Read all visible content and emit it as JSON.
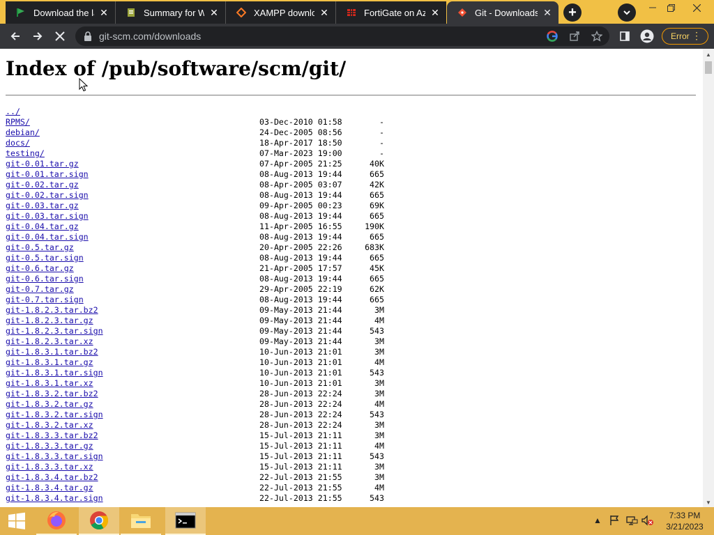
{
  "browser": {
    "tabs": [
      {
        "title": "Download the lat",
        "favicon": "flag-icon",
        "active": false
      },
      {
        "title": "Summary for Win",
        "favicon": "document-icon",
        "active": false
      },
      {
        "title": "XAMPP downloac",
        "favicon": "xampp-icon",
        "active": false
      },
      {
        "title": "FortiGate on Azu",
        "favicon": "fortinet-icon",
        "active": false
      },
      {
        "title": "Git - Downloads",
        "favicon": "git-icon",
        "active": true
      }
    ],
    "url": "git-scm.com/downloads",
    "error_label": "Error"
  },
  "page": {
    "heading": "Index of /pub/software/scm/git/",
    "entries": [
      {
        "name": "../",
        "date": "",
        "size": ""
      },
      {
        "name": "RPMS/",
        "date": "03-Dec-2010 01:58",
        "size": "-"
      },
      {
        "name": "debian/",
        "date": "24-Dec-2005 08:56",
        "size": "-"
      },
      {
        "name": "docs/",
        "date": "18-Apr-2017 18:50",
        "size": "-"
      },
      {
        "name": "testing/",
        "date": "07-Mar-2023 19:00",
        "size": "-"
      },
      {
        "name": "git-0.01.tar.gz",
        "date": "07-Apr-2005 21:25",
        "size": "40K"
      },
      {
        "name": "git-0.01.tar.sign",
        "date": "08-Aug-2013 19:44",
        "size": "665"
      },
      {
        "name": "git-0.02.tar.gz",
        "date": "08-Apr-2005 03:07",
        "size": "42K"
      },
      {
        "name": "git-0.02.tar.sign",
        "date": "08-Aug-2013 19:44",
        "size": "665"
      },
      {
        "name": "git-0.03.tar.gz",
        "date": "09-Apr-2005 00:23",
        "size": "69K"
      },
      {
        "name": "git-0.03.tar.sign",
        "date": "08-Aug-2013 19:44",
        "size": "665"
      },
      {
        "name": "git-0.04.tar.gz",
        "date": "11-Apr-2005 16:55",
        "size": "190K"
      },
      {
        "name": "git-0.04.tar.sign",
        "date": "08-Aug-2013 19:44",
        "size": "665"
      },
      {
        "name": "git-0.5.tar.gz",
        "date": "20-Apr-2005 22:26",
        "size": "683K"
      },
      {
        "name": "git-0.5.tar.sign",
        "date": "08-Aug-2013 19:44",
        "size": "665"
      },
      {
        "name": "git-0.6.tar.gz",
        "date": "21-Apr-2005 17:57",
        "size": "45K"
      },
      {
        "name": "git-0.6.tar.sign",
        "date": "08-Aug-2013 19:44",
        "size": "665"
      },
      {
        "name": "git-0.7.tar.gz",
        "date": "29-Apr-2005 22:19",
        "size": "62K"
      },
      {
        "name": "git-0.7.tar.sign",
        "date": "08-Aug-2013 19:44",
        "size": "665"
      },
      {
        "name": "git-1.8.2.3.tar.bz2",
        "date": "09-May-2013 21:44",
        "size": "3M"
      },
      {
        "name": "git-1.8.2.3.tar.gz",
        "date": "09-May-2013 21:44",
        "size": "4M"
      },
      {
        "name": "git-1.8.2.3.tar.sign",
        "date": "09-May-2013 21:44",
        "size": "543"
      },
      {
        "name": "git-1.8.2.3.tar.xz",
        "date": "09-May-2013 21:44",
        "size": "3M"
      },
      {
        "name": "git-1.8.3.1.tar.bz2",
        "date": "10-Jun-2013 21:01",
        "size": "3M"
      },
      {
        "name": "git-1.8.3.1.tar.gz",
        "date": "10-Jun-2013 21:01",
        "size": "4M"
      },
      {
        "name": "git-1.8.3.1.tar.sign",
        "date": "10-Jun-2013 21:01",
        "size": "543"
      },
      {
        "name": "git-1.8.3.1.tar.xz",
        "date": "10-Jun-2013 21:01",
        "size": "3M"
      },
      {
        "name": "git-1.8.3.2.tar.bz2",
        "date": "28-Jun-2013 22:24",
        "size": "3M"
      },
      {
        "name": "git-1.8.3.2.tar.gz",
        "date": "28-Jun-2013 22:24",
        "size": "4M"
      },
      {
        "name": "git-1.8.3.2.tar.sign",
        "date": "28-Jun-2013 22:24",
        "size": "543"
      },
      {
        "name": "git-1.8.3.2.tar.xz",
        "date": "28-Jun-2013 22:24",
        "size": "3M"
      },
      {
        "name": "git-1.8.3.3.tar.bz2",
        "date": "15-Jul-2013 21:11",
        "size": "3M"
      },
      {
        "name": "git-1.8.3.3.tar.gz",
        "date": "15-Jul-2013 21:11",
        "size": "4M"
      },
      {
        "name": "git-1.8.3.3.tar.sign",
        "date": "15-Jul-2013 21:11",
        "size": "543"
      },
      {
        "name": "git-1.8.3.3.tar.xz",
        "date": "15-Jul-2013 21:11",
        "size": "3M"
      },
      {
        "name": "git-1.8.3.4.tar.bz2",
        "date": "22-Jul-2013 21:55",
        "size": "3M"
      },
      {
        "name": "git-1.8.3.4.tar.gz",
        "date": "22-Jul-2013 21:55",
        "size": "4M"
      },
      {
        "name": "git-1.8.3.4.tar.sign",
        "date": "22-Jul-2013 21:55",
        "size": "543"
      }
    ]
  },
  "taskbar": {
    "apps": [
      "windows-start-icon",
      "firefox-icon",
      "chrome-icon",
      "file-explorer-icon",
      "command-prompt-icon"
    ],
    "clock_time": "7:33 PM",
    "clock_date": "3/21/2023"
  },
  "colors": {
    "tabstrip": "#f1c045",
    "taskbar": "#e4b34f",
    "link": "#1a0dab",
    "error_accent": "#f29900"
  }
}
